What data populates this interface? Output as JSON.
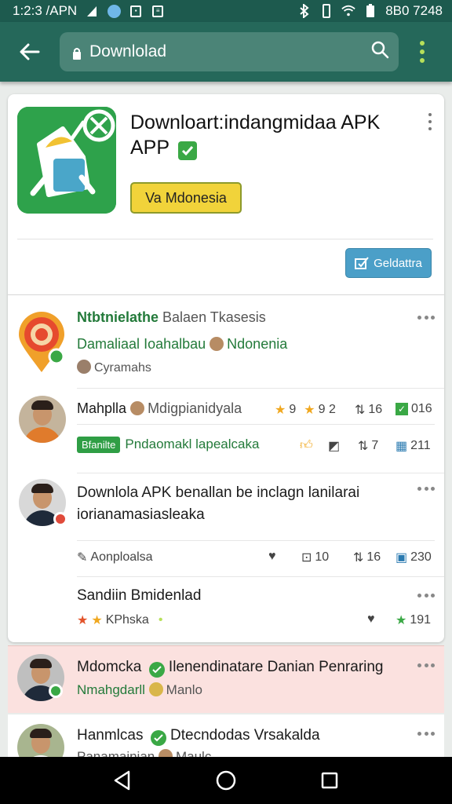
{
  "status_bar": {
    "time": "1:2:3 /APN",
    "right_text": "8B0 7248",
    "icons": [
      "signal-icon",
      "notification-bubble-icon",
      "photo-icon",
      "news-icon",
      "bluetooth-icon",
      "vibrate-icon",
      "wifi-icon",
      "battery-icon"
    ]
  },
  "toolbar": {
    "url": "Downlolad"
  },
  "app": {
    "title": "Downloart:indangmidaa APK APP",
    "region_button": "Va Mdonesia",
    "download_button": "Geldattra"
  },
  "rows": [
    {
      "title": "Ntbtnielathe",
      "subtitle": "Balaen Tkasesis",
      "line2_a": "Damaliaal",
      "line2_b": "Ioahalbau",
      "line2_c": "Ndonenia",
      "line3": "Cyramahs"
    },
    {
      "name": "Mahplla",
      "handle": "Mdigpianidyala",
      "stat1": "9",
      "stat2": "9 2",
      "stat3": "16",
      "stat4": "016",
      "badge": "Bfanilte",
      "tagline": "Pndaomakl lapealcaka",
      "stat5": "7",
      "stat6": "211"
    },
    {
      "text": "Downlola APK benallan be inclagn lanilarai iorianamasiasleaka",
      "meta": "Aonploalsa",
      "stat1": "10",
      "stat2": "16",
      "stat3": "230"
    },
    {
      "title": "Sandiin Bmidenlad",
      "meta": "KPhska",
      "stat": "191"
    },
    {
      "name": "Mdomcka",
      "text": "Ilenendinatare Danian Penraring",
      "sub_a": "Nmahgdarll",
      "sub_b": "Manlo"
    },
    {
      "name": "Hanmlcas",
      "text": "Dtecndodas Vrsakalda",
      "sub_a": "Panamainian",
      "sub_b": "Maulc"
    }
  ],
  "colors": {
    "status_bar": "#1d5a4e",
    "toolbar": "#25685a",
    "accent_green": "#3aa845",
    "download_blue": "#4b9fc8",
    "region_yellow": "#f1d33a",
    "highlight_pink": "#fbe1df"
  }
}
